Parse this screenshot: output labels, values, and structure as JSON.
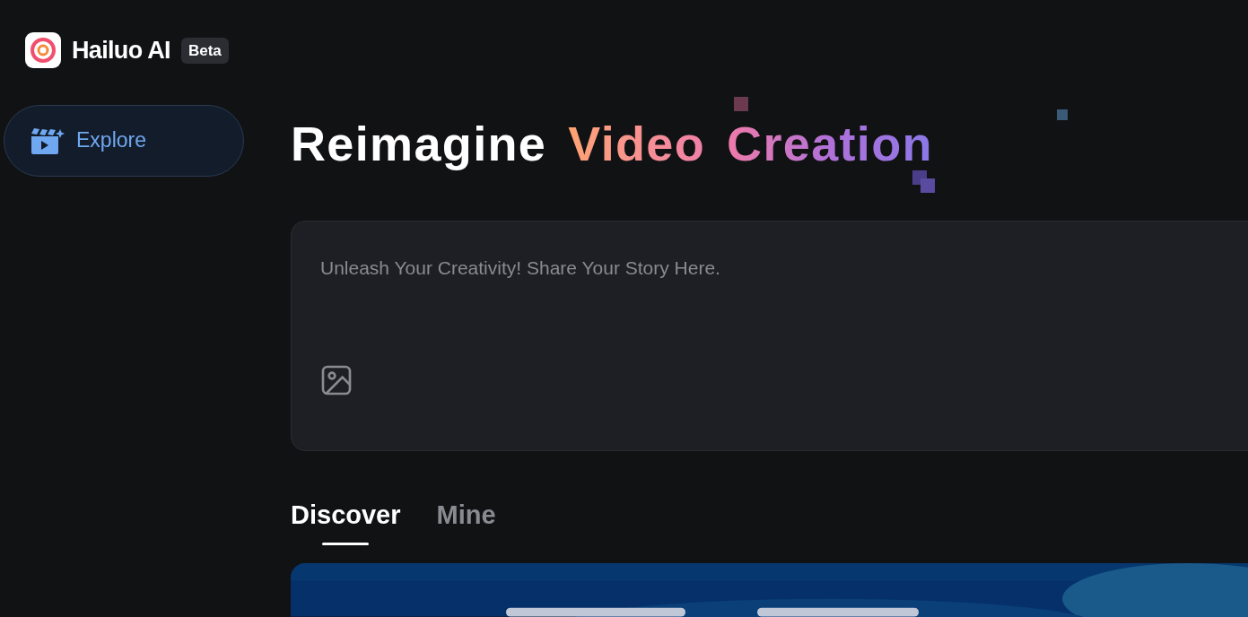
{
  "brand": {
    "name": "Hailuo AI",
    "badge": "Beta"
  },
  "sidebar": {
    "items": [
      {
        "label": "Explore",
        "selected": true
      }
    ]
  },
  "headline": {
    "parts": [
      {
        "text": "Reimagine",
        "kind": "plain"
      },
      {
        "text": "Video",
        "kind": "warm"
      },
      {
        "text": "Creation",
        "kind": "cool"
      }
    ]
  },
  "prompt": {
    "placeholder": "Unleash Your Creativity! Share Your Story Here."
  },
  "tabs": [
    {
      "label": "Discover",
      "selected": true
    },
    {
      "label": "Mine",
      "selected": false
    }
  ]
}
